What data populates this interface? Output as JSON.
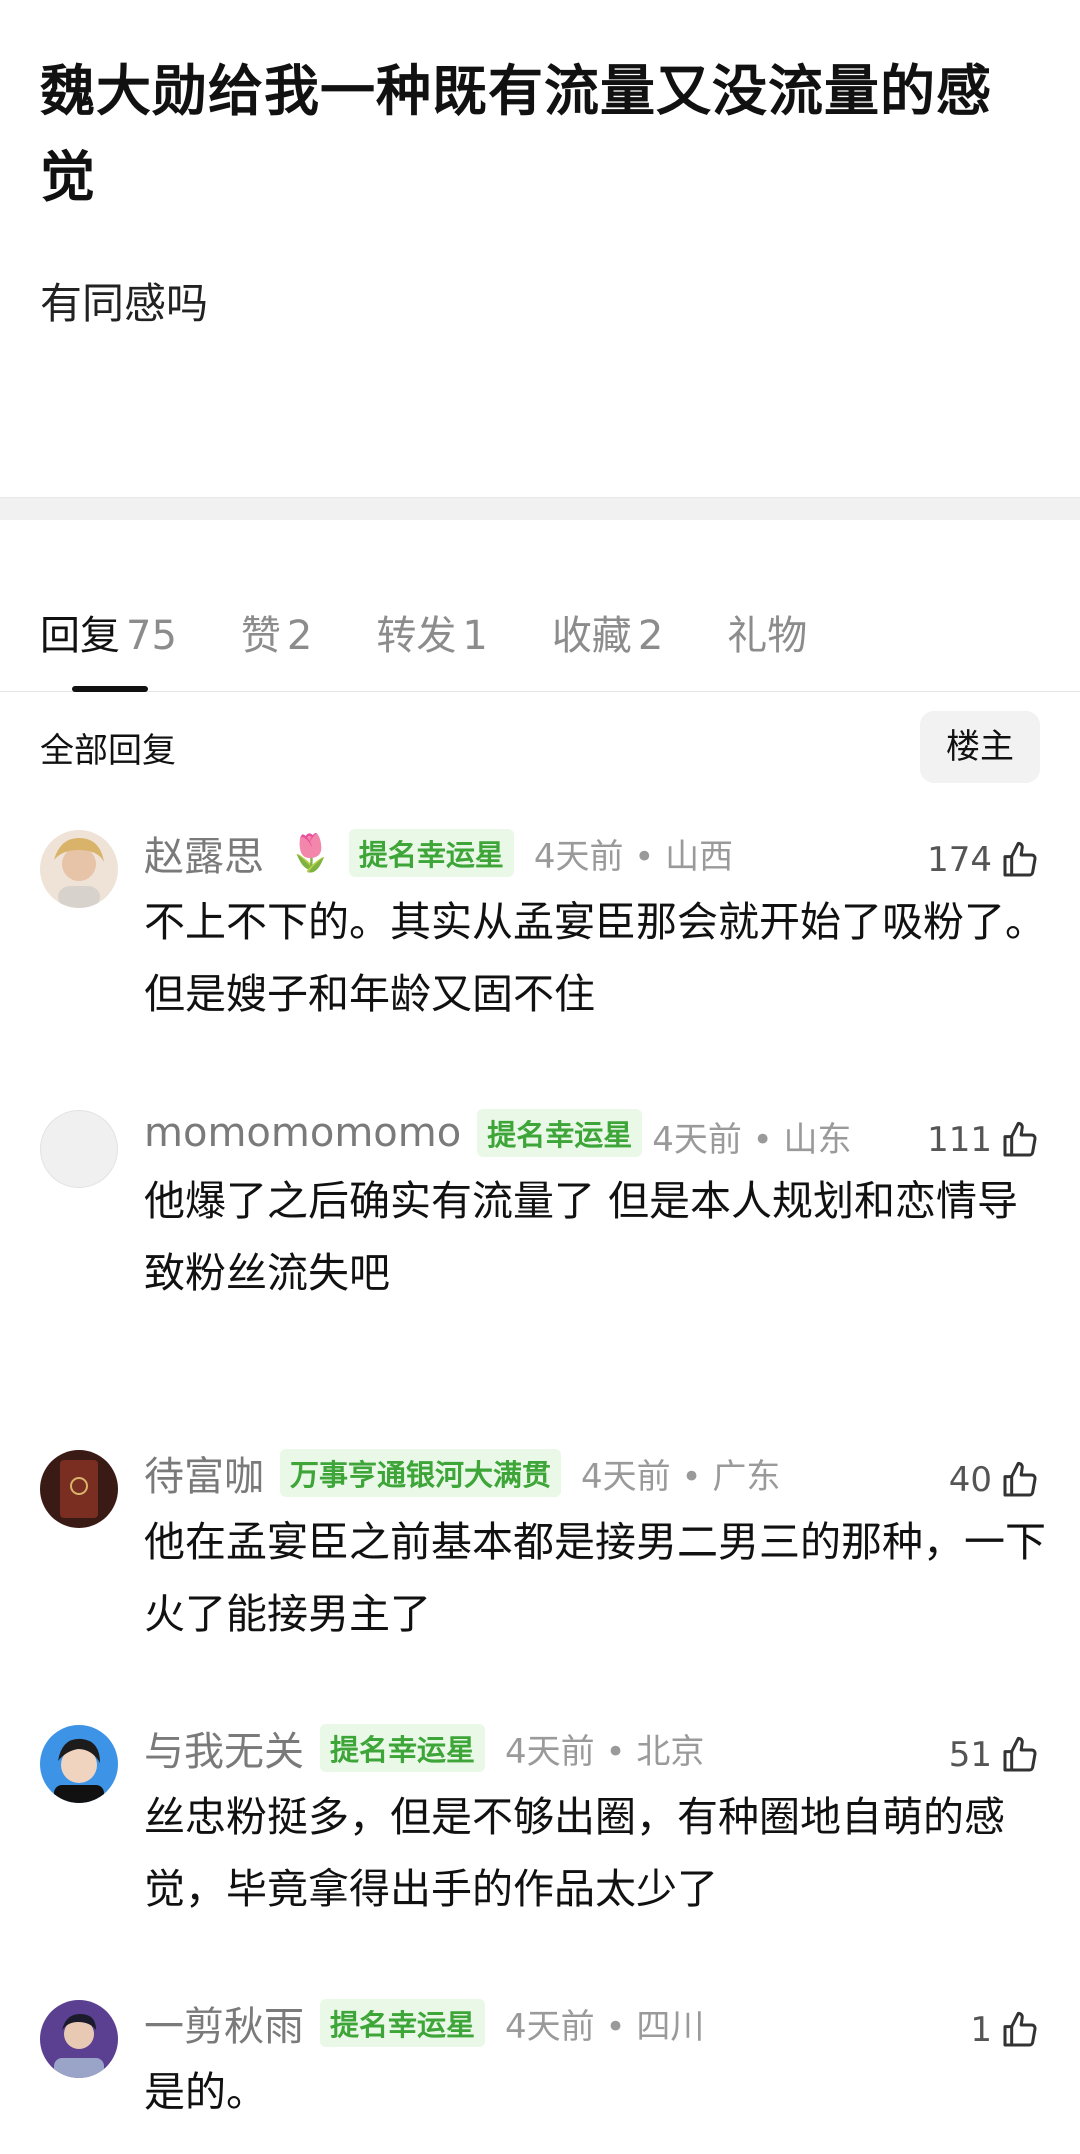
{
  "post": {
    "title": "魏大勋给我一种既有流量又没流量的感觉",
    "body": "有同感吗"
  },
  "tabs": [
    {
      "label": "回复",
      "count": "75",
      "active": true
    },
    {
      "label": "赞",
      "count": "2"
    },
    {
      "label": "转发",
      "count": "1"
    },
    {
      "label": "收藏",
      "count": "2"
    },
    {
      "label": "礼物",
      "count": ""
    }
  ],
  "filter": {
    "label": "全部回复",
    "owner_button": "楼主"
  },
  "comments": [
    {
      "user": "赵露思",
      "flower": "🌷",
      "badge": "提名幸运星",
      "meta": "4天前 • 山西",
      "likes": "174",
      "text": "不上不下的。其实从孟宴臣那会就开始了吸粉了。但是嫂子和年龄又固不住",
      "avatar_color": "#e9d3c4"
    },
    {
      "user": "momomomomo",
      "badge": "提名幸运星",
      "meta": "4天前 • 山东",
      "likes": "111",
      "text": "他爆了之后确实有流量了 但是本人规划和恋情导致粉丝流失吧",
      "avatar_color": "#f0f0f0"
    },
    {
      "user": "待富咖",
      "badge": "万事亨通银河大满贯",
      "meta": "4天前 • 广东",
      "likes": "40",
      "text": "他在孟宴臣之前基本都是接男二男三的那种，一下火了能接男主了",
      "avatar_color": "#6b2a1f"
    },
    {
      "user": "与我无关",
      "badge": "提名幸运星",
      "meta": "4天前 • 北京",
      "likes": "51",
      "text": "丝忠粉挺多，但是不够出圈，有种圈地自萌的感觉，毕竟拿得出手的作品太少了",
      "avatar_color": "#2a7fd8"
    },
    {
      "user": "一剪秋雨",
      "badge": "提名幸运星",
      "meta": "4天前 • 四川",
      "likes": "1",
      "text": "是的。",
      "avatar_color": "#5a3d8c"
    }
  ]
}
